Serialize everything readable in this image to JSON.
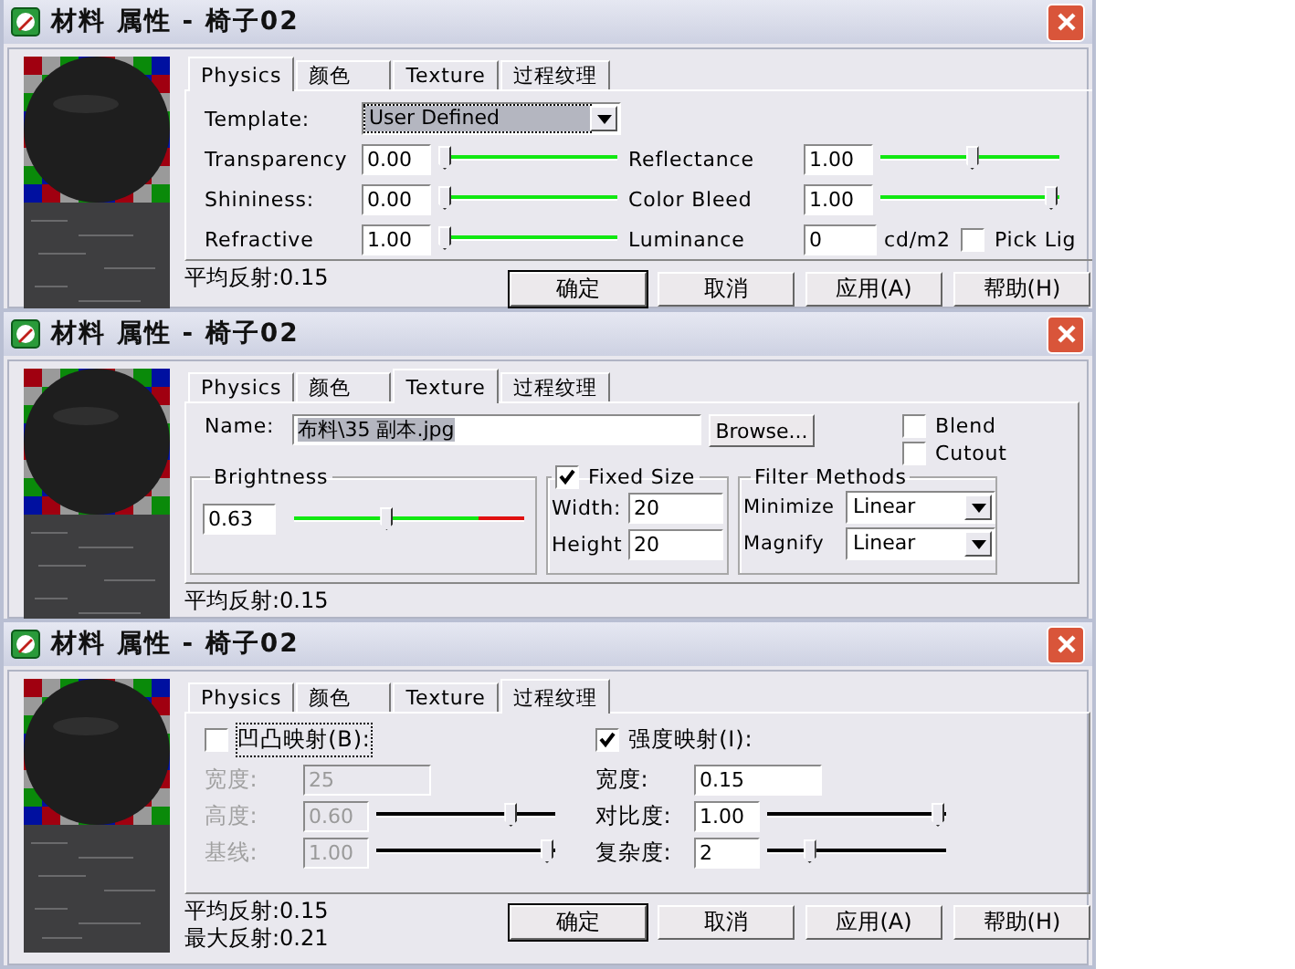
{
  "windows": [
    {
      "title": "材料 属性 - 椅子02",
      "tabs": [
        {
          "label": "Physics",
          "selected": true
        },
        {
          "label": "颜色",
          "selected": false
        },
        {
          "label": "Texture",
          "selected": false
        },
        {
          "label": "过程纹理",
          "selected": false
        }
      ],
      "panel": {
        "kind": "physics",
        "template": {
          "label": "Template:",
          "value": "User Defined",
          "focused": true
        },
        "rows": [
          {
            "left": {
              "label": "Transparency",
              "value": "0.00",
              "level": 0
            },
            "right": {
              "kind": "slider",
              "label": "Reflectance",
              "value": "1.00",
              "level": 0.52
            }
          },
          {
            "left": {
              "label": "Shininess:",
              "value": "0.00",
              "level": 0
            },
            "right": {
              "kind": "slider",
              "label": "Color Bleed",
              "value": "1.00",
              "level": 1
            }
          },
          {
            "left": {
              "label": "Refractive",
              "value": "1.00",
              "level": 0
            },
            "right": {
              "kind": "unit",
              "label": "Luminance",
              "value": "0",
              "unit": "cd/m2",
              "checkbox": {
                "label": "Pick Lig",
                "checked": false
              }
            }
          }
        ]
      },
      "stats": [
        "平均反射:0.15"
      ],
      "buttons": [
        {
          "label": "确定",
          "default": true
        },
        {
          "label": "取消",
          "default": false
        },
        {
          "label": "应用(A)",
          "default": false
        },
        {
          "label": "帮助(H)",
          "default": false
        }
      ]
    },
    {
      "title": "材料 属性 - 椅子02",
      "tabs": [
        {
          "label": "Physics",
          "selected": false
        },
        {
          "label": "颜色",
          "selected": false
        },
        {
          "label": "Texture",
          "selected": true
        },
        {
          "label": "过程纹理",
          "selected": false
        }
      ],
      "panel": {
        "kind": "texture",
        "name": {
          "label": "Name:",
          "value": "布料\\35 副本.jpg",
          "highlighted": true
        },
        "browse": "Browse...",
        "options": [
          {
            "label": "Blend",
            "checked": false
          },
          {
            "label": "Cutout",
            "checked": false
          }
        ],
        "brightness": {
          "title": "Brightness",
          "value": "0.63",
          "level": 0.4
        },
        "fixed_size": {
          "label": "Fixed Size",
          "checked": true,
          "fields": [
            {
              "label": "Width:",
              "value": "20"
            },
            {
              "label": "Height",
              "value": "20"
            }
          ]
        },
        "filter": {
          "title": "Filter Methods",
          "fields": [
            {
              "label": "Minimize",
              "value": "Linear"
            },
            {
              "label": "Magnify",
              "value": "Linear"
            }
          ]
        }
      },
      "stats": [
        "平均反射:0.15"
      ]
    },
    {
      "title": "材料 属性 - 椅子02",
      "tabs": [
        {
          "label": "Physics",
          "selected": false
        },
        {
          "label": "颜色",
          "selected": false
        },
        {
          "label": "Texture",
          "selected": false
        },
        {
          "label": "过程纹理",
          "selected": true
        }
      ],
      "panel": {
        "kind": "procedural",
        "groups": [
          {
            "label": "凹凸映射(B):",
            "checked": false,
            "focused": true,
            "fields": [
              {
                "kind": "text",
                "label": "宽度:",
                "value": "25",
                "disabled": true
              },
              {
                "kind": "slider",
                "label": "高度:",
                "value": "0.60",
                "level": 0.78,
                "disabled": true
              },
              {
                "kind": "slider",
                "label": "基线:",
                "value": "1.00",
                "level": 1,
                "disabled": true
              }
            ]
          },
          {
            "label": "强度映射(I):",
            "checked": true,
            "focused": false,
            "fields": [
              {
                "kind": "text",
                "label": "宽度:",
                "value": "0.15",
                "disabled": false
              },
              {
                "kind": "slider",
                "label": "对比度:",
                "value": "1.00",
                "level": 1,
                "disabled": false
              },
              {
                "kind": "slider",
                "label": "复杂度:",
                "value": "2",
                "level": 0.22,
                "disabled": false
              }
            ]
          }
        ]
      },
      "stats": [
        "平均反射:0.15",
        "最大反射:0.21"
      ],
      "buttons": [
        {
          "label": "确定",
          "default": true
        },
        {
          "label": "取消",
          "default": false
        },
        {
          "label": "应用(A)",
          "default": false
        },
        {
          "label": "帮助(H)",
          "default": false
        }
      ]
    }
  ]
}
